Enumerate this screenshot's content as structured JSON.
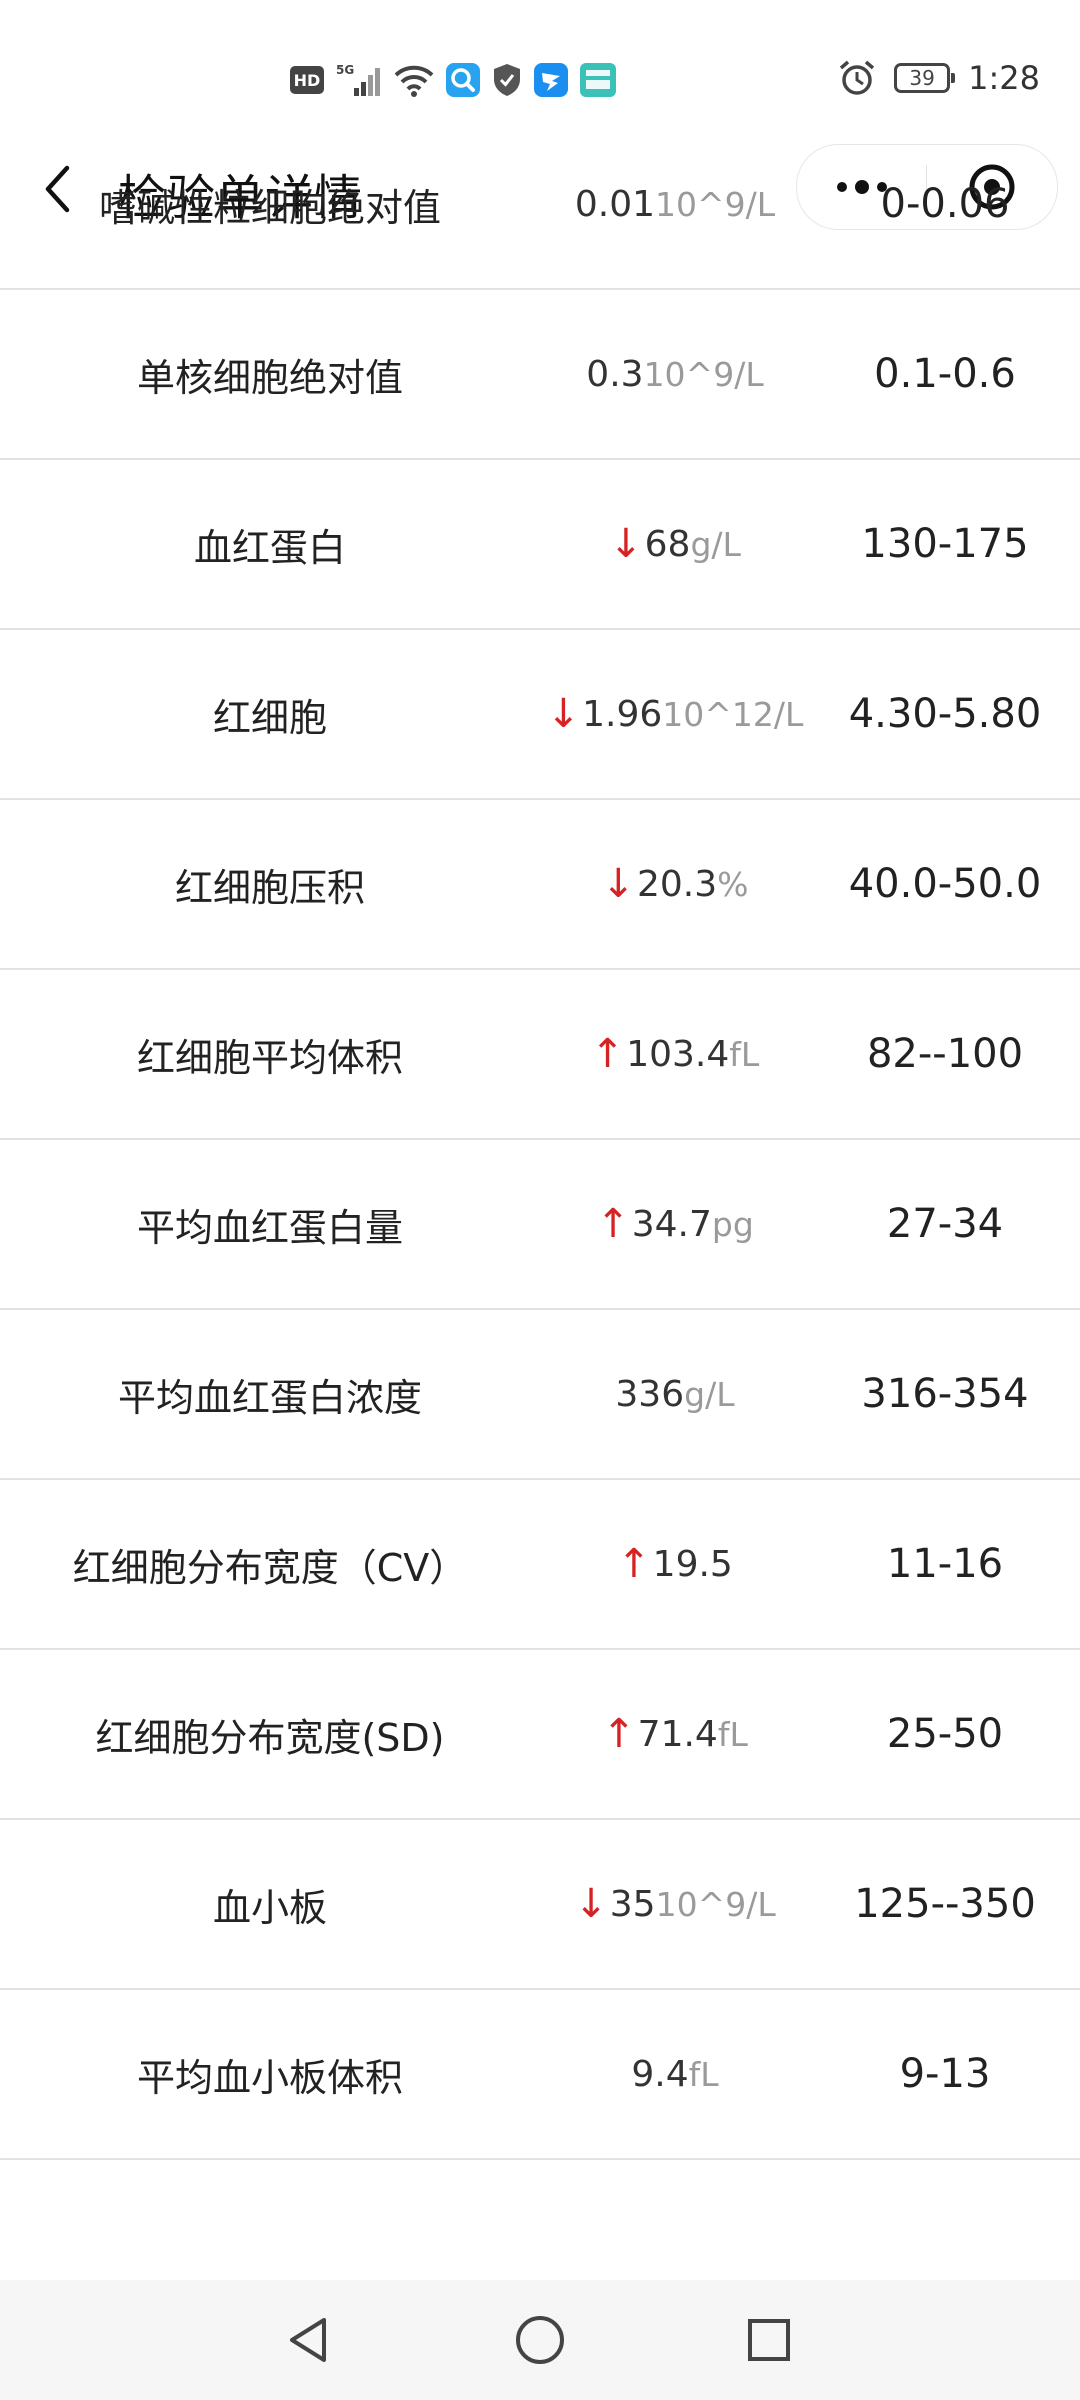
{
  "status_bar": {
    "hd": "HD",
    "network": "5G",
    "battery": "39",
    "time": "1:28"
  },
  "header": {
    "title": "检验单详情"
  },
  "rows": [
    {
      "name": "嗜碱性粒细胞绝对值",
      "arrow": "",
      "value": "0.01",
      "unit": "10^9/L",
      "range": "0-0.06"
    },
    {
      "name": "单核细胞绝对值",
      "arrow": "",
      "value": "0.3",
      "unit": "10^9/L",
      "range": "0.1-0.6"
    },
    {
      "name": "血红蛋白",
      "arrow": "↓",
      "value": "68",
      "unit": "g/L",
      "range": "130-175"
    },
    {
      "name": "红细胞",
      "arrow": "↓",
      "value": "1.96",
      "unit": "10^12/L",
      "range": "4.30-5.80"
    },
    {
      "name": "红细胞压积",
      "arrow": "↓",
      "value": "20.3",
      "unit": "%",
      "range": "40.0-50.0"
    },
    {
      "name": "红细胞平均体积",
      "arrow": "↑",
      "value": "103.4",
      "unit": "fL",
      "range": "82--100"
    },
    {
      "name": "平均血红蛋白量",
      "arrow": "↑",
      "value": "34.7",
      "unit": "pg",
      "range": "27-34"
    },
    {
      "name": "平均血红蛋白浓度",
      "arrow": "",
      "value": "336",
      "unit": "g/L",
      "range": "316-354"
    },
    {
      "name": "红细胞分布宽度（CV）",
      "arrow": "↑",
      "value": "19.5",
      "unit": "",
      "range": "11-16"
    },
    {
      "name": "红细胞分布宽度(SD)",
      "arrow": "↑",
      "value": "71.4",
      "unit": "fL",
      "range": "25-50"
    },
    {
      "name": "血小板",
      "arrow": "↓",
      "value": "35",
      "unit": "10^9/L",
      "range": "125--350"
    },
    {
      "name": "平均血小板体积",
      "arrow": "",
      "value": "9.4",
      "unit": "fL",
      "range": "9-13"
    }
  ],
  "colors": {
    "abnormal_arrow": "#d62222",
    "unit_text": "#9a9a9a"
  },
  "nav": {
    "icons": [
      "back-triangle-icon",
      "home-circle-icon",
      "recents-square-icon"
    ]
  }
}
